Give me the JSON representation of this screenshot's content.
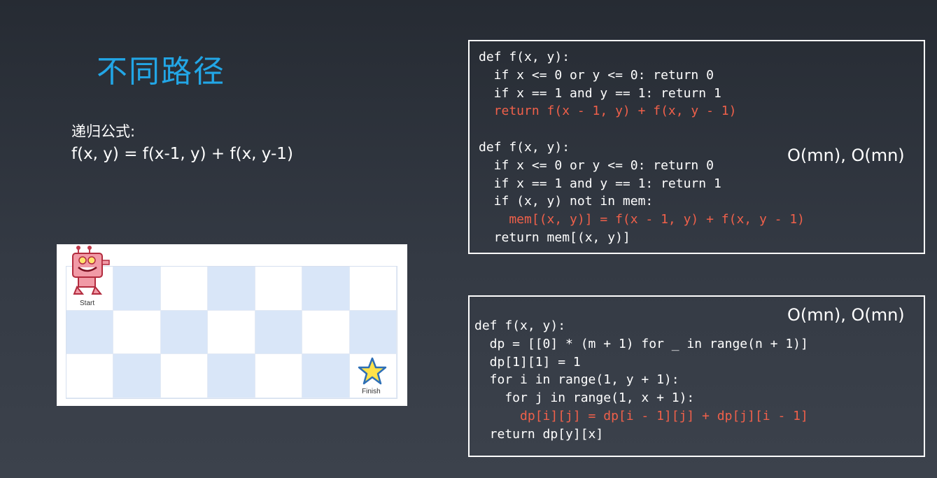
{
  "title": "不同路径",
  "formula": {
    "label": "递归公式:",
    "expression": "f(x, y) = f(x-1, y) + f(x, y-1)"
  },
  "grid": {
    "rows": 3,
    "cols": 7,
    "start_label": "Start",
    "finish_label": "Finish",
    "colors": {
      "blue": "#d9e6f8",
      "white": "#ffffff"
    }
  },
  "code_block_1": {
    "lines": [
      {
        "text": "def f(x, y):",
        "highlight": false
      },
      {
        "text": "  if x <= 0 or y <= 0: return 0",
        "highlight": false
      },
      {
        "text": "  if x == 1 and y == 1: return 1",
        "highlight": false
      },
      {
        "text": "  return f(x - 1, y) + f(x, y - 1)",
        "highlight": true
      },
      {
        "text": "",
        "highlight": false
      },
      {
        "text": "def f(x, y):",
        "highlight": false
      },
      {
        "text": "  if x <= 0 or y <= 0: return 0",
        "highlight": false
      },
      {
        "text": "  if x == 1 and y == 1: return 1",
        "highlight": false
      },
      {
        "text": "  if (x, y) not in mem:",
        "highlight": false
      },
      {
        "text": "    mem[(x, y)] = f(x - 1, y) + f(x, y - 1)",
        "highlight": true
      },
      {
        "text": "  return mem[(x, y)]",
        "highlight": false
      }
    ],
    "complexity": "O(mn), O(mn)"
  },
  "code_block_2": {
    "lines": [
      {
        "text": "def f(x, y):",
        "highlight": false
      },
      {
        "text": "  dp = [[0] * (m + 1) for _ in range(n + 1)]",
        "highlight": false
      },
      {
        "text": "  dp[1][1] = 1",
        "highlight": false
      },
      {
        "text": "  for i in range(1, y + 1):",
        "highlight": false
      },
      {
        "text": "    for j in range(1, x + 1):",
        "highlight": false
      },
      {
        "text": "      dp[i][j] = dp[i - 1][j] + dp[j][i - 1]",
        "highlight": true
      },
      {
        "text": "  return dp[y][x]",
        "highlight": false
      }
    ],
    "complexity": "O(mn), O(mn)"
  },
  "colors": {
    "title": "#22a6e6",
    "highlight": "#f0604a",
    "text": "#ffffff"
  }
}
